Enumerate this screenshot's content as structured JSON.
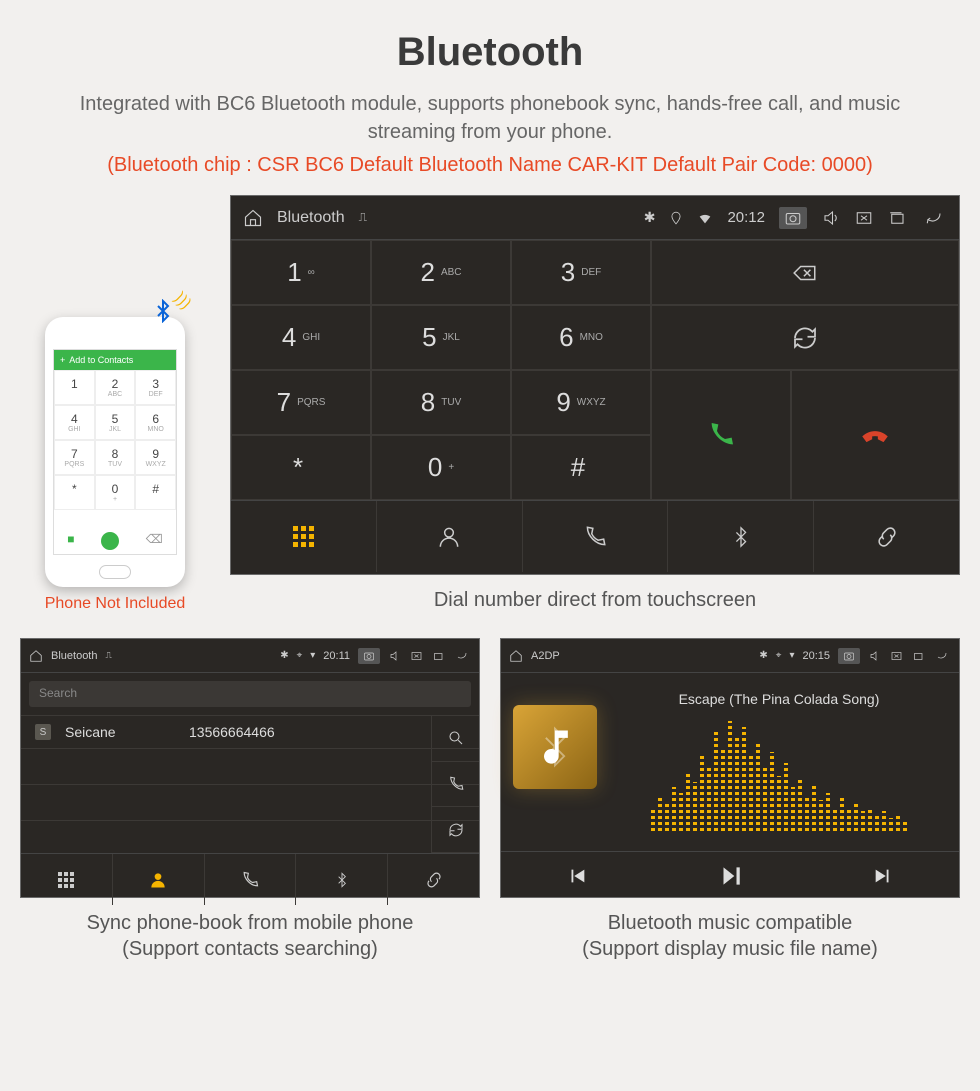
{
  "header": {
    "title": "Bluetooth",
    "subtitle": "Integrated with BC6 Bluetooth module, supports phonebook sync, hands-free call, and music streaming from your phone.",
    "spec": "(Bluetooth chip : CSR BC6    Default Bluetooth Name CAR-KIT    Default Pair Code: 0000)"
  },
  "phone": {
    "top_label": "Add to Contacts",
    "keys": [
      {
        "n": "1",
        "s": ""
      },
      {
        "n": "2",
        "s": "ABC"
      },
      {
        "n": "3",
        "s": "DEF"
      },
      {
        "n": "4",
        "s": "GHI"
      },
      {
        "n": "5",
        "s": "JKL"
      },
      {
        "n": "6",
        "s": "MNO"
      },
      {
        "n": "7",
        "s": "PQRS"
      },
      {
        "n": "8",
        "s": "TUV"
      },
      {
        "n": "9",
        "s": "WXYZ"
      },
      {
        "n": "*",
        "s": ""
      },
      {
        "n": "0",
        "s": "+"
      },
      {
        "n": "#",
        "s": ""
      }
    ],
    "footnote": "Phone Not Included"
  },
  "dialer": {
    "status": {
      "title": "Bluetooth",
      "time": "20:12"
    },
    "keys": [
      {
        "n": "1",
        "s": "∞"
      },
      {
        "n": "2",
        "s": "ABC"
      },
      {
        "n": "3",
        "s": "DEF"
      },
      {
        "n": "4",
        "s": "GHI"
      },
      {
        "n": "5",
        "s": "JKL"
      },
      {
        "n": "6",
        "s": "MNO"
      },
      {
        "n": "7",
        "s": "PQRS"
      },
      {
        "n": "8",
        "s": "TUV"
      },
      {
        "n": "9",
        "s": "WXYZ"
      },
      {
        "n": "*",
        "s": ""
      },
      {
        "n": "0",
        "s": "+"
      },
      {
        "n": "#",
        "s": ""
      }
    ],
    "caption": "Dial number direct from touchscreen"
  },
  "phonebook": {
    "status": {
      "title": "Bluetooth",
      "time": "20:11"
    },
    "search_placeholder": "Search",
    "contact": {
      "badge": "S",
      "name": "Seicane",
      "number": "13566664466"
    },
    "caption_line1": "Sync phone-book from mobile phone",
    "caption_line2": "(Support contacts searching)"
  },
  "music": {
    "status": {
      "title": "A2DP",
      "time": "20:15"
    },
    "track": "Escape (The Pina Colada Song)",
    "caption_line1": "Bluetooth music compatible",
    "caption_line2": "(Support display music file name)"
  }
}
